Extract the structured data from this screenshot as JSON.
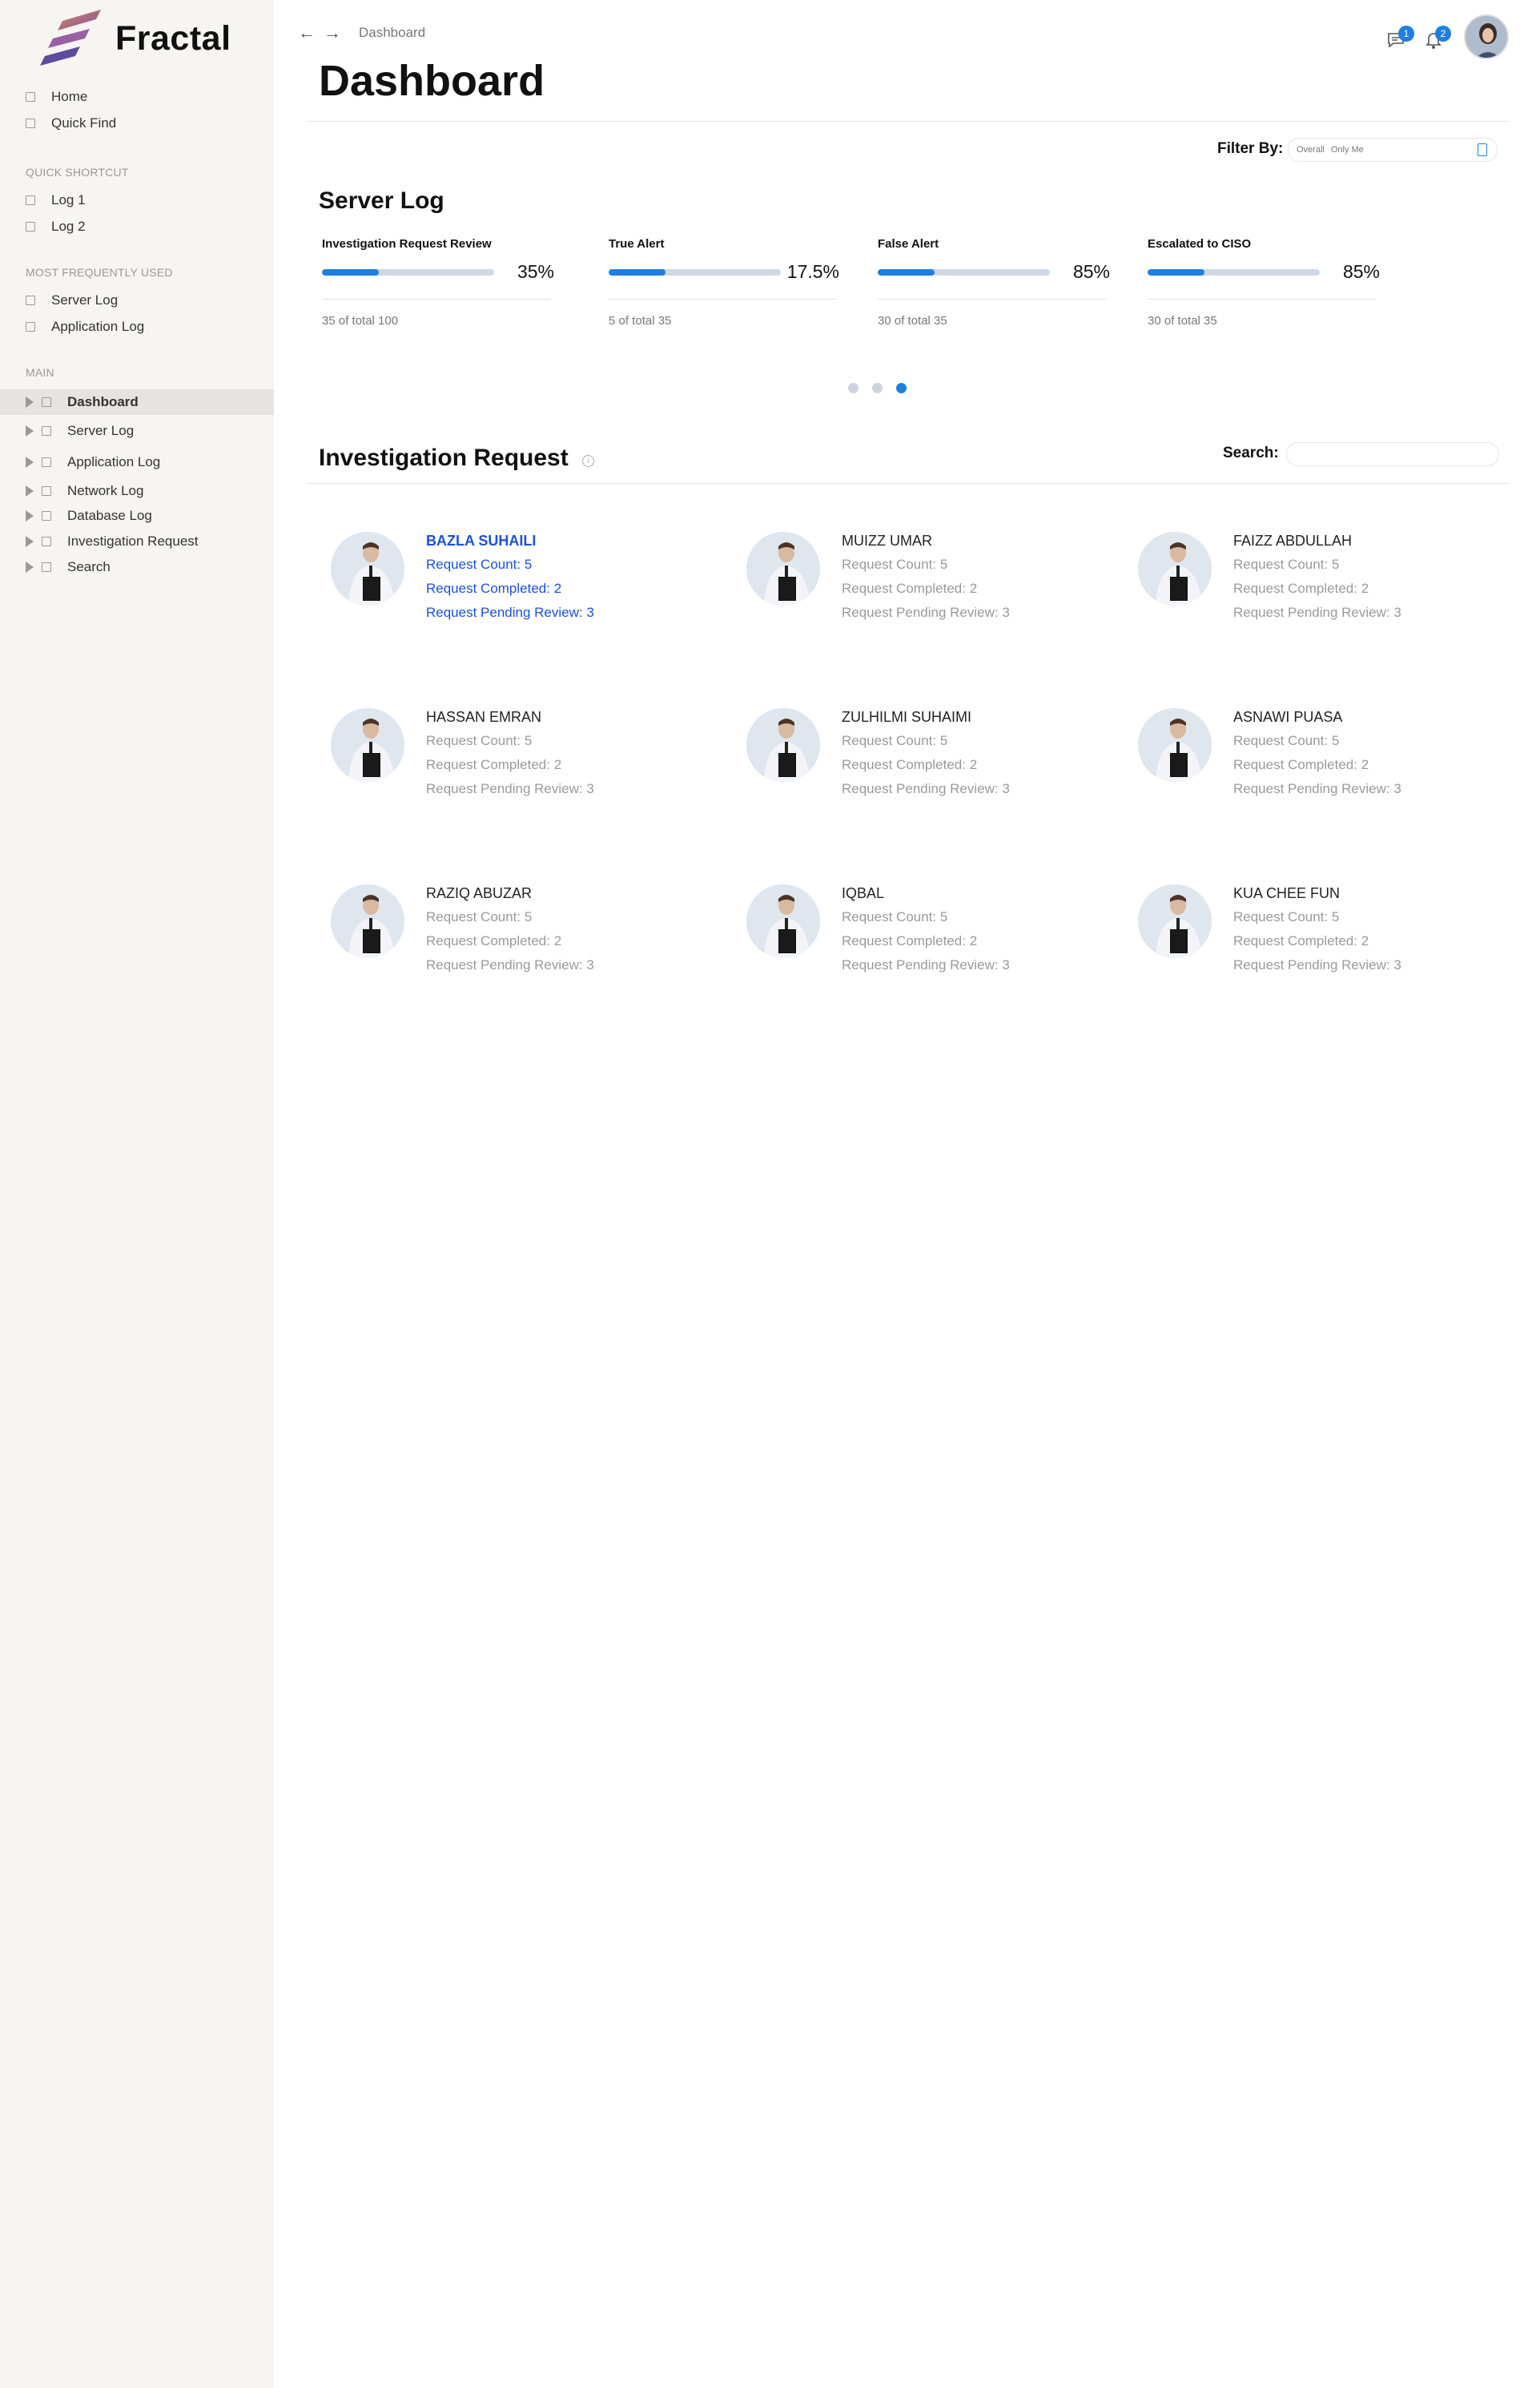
{
  "brand": {
    "name": "Fractal"
  },
  "sidebar": {
    "top_items": [
      {
        "label": "Home"
      },
      {
        "label": "Quick Find"
      }
    ],
    "quick_shortcut": {
      "heading": "QUICK SHORTCUT",
      "items": [
        {
          "label": "Log 1"
        },
        {
          "label": "Log 2"
        }
      ]
    },
    "most_used": {
      "heading": "MOST FREQUENTLY USED",
      "items": [
        {
          "label": "Server Log"
        },
        {
          "label": "Application Log"
        }
      ]
    },
    "main": {
      "heading": "MAIN",
      "items": [
        {
          "label": "Dashboard",
          "active": true
        },
        {
          "label": "Server Log"
        },
        {
          "label": "Application Log"
        },
        {
          "label": "Network Log"
        },
        {
          "label": "Database Log"
        },
        {
          "label": "Investigation Request"
        },
        {
          "label": "Search"
        }
      ]
    }
  },
  "header": {
    "breadcrumb": "Dashboard",
    "messages_badge": "1",
    "notifications_badge": "2",
    "title": "Dashboard"
  },
  "filter": {
    "label": "Filter By:",
    "options": [
      "Overall",
      "Only Me"
    ]
  },
  "server_log": {
    "title": "Server Log",
    "stats": [
      {
        "label": "Investigation Request Review",
        "percent": "35%",
        "progress": 0.33,
        "sub": "35 of total 100"
      },
      {
        "label": "True Alert",
        "percent": "17.5%",
        "progress": 0.33,
        "sub": "5 of total 35"
      },
      {
        "label": "False Alert",
        "percent": "85%",
        "progress": 0.33,
        "sub": "30 of total 35"
      },
      {
        "label": "Escalated to CISO",
        "percent": "85%",
        "progress": 0.33,
        "sub": "30 of total 35"
      }
    ],
    "pager": {
      "count": 3,
      "active": 3
    }
  },
  "investigation": {
    "title": "Investigation Request",
    "search_label": "Search:",
    "search_value": "",
    "cards": [
      {
        "name": "BAZLA SUHAILI",
        "count": "Request Count: 5",
        "completed": "Request Completed: 2",
        "pending": "Request Pending Review: 3",
        "highlight": true
      },
      {
        "name": "MUIZZ UMAR",
        "count": "Request Count: 5",
        "completed": "Request Completed: 2",
        "pending": "Request Pending Review: 3"
      },
      {
        "name": "FAIZZ ABDULLAH",
        "count": "Request Count: 5",
        "completed": "Request Completed: 2",
        "pending": "Request Pending Review: 3"
      },
      {
        "name": "HASSAN EMRAN",
        "count": "Request Count: 5",
        "completed": "Request Completed: 2",
        "pending": "Request Pending Review: 3"
      },
      {
        "name": "ZULHILMI SUHAIMI",
        "count": "Request Count: 5",
        "completed": "Request Completed: 2",
        "pending": "Request Pending Review: 3"
      },
      {
        "name": "ASNAWI PUASA",
        "count": "Request Count: 5",
        "completed": "Request Completed: 2",
        "pending": "Request Pending Review: 3"
      },
      {
        "name": "RAZIQ ABUZAR",
        "count": "Request Count: 5",
        "completed": "Request Completed: 2",
        "pending": "Request Pending Review: 3"
      },
      {
        "name": "IQBAL",
        "count": "Request Count: 5",
        "completed": "Request Completed: 2",
        "pending": "Request Pending Review: 3"
      },
      {
        "name": "KUA CHEE FUN",
        "count": "Request Count: 5",
        "completed": "Request Completed: 2",
        "pending": "Request Pending Review: 3"
      }
    ]
  },
  "colors": {
    "accent": "#1f7fe0",
    "highlight_text": "#1b51d8",
    "sidebar_bg": "#f6f5f2"
  },
  "icons": [
    "logo-icon",
    "back-arrow-icon",
    "forward-arrow-icon",
    "chat-icon",
    "bell-icon",
    "info-icon",
    "select-icon"
  ]
}
